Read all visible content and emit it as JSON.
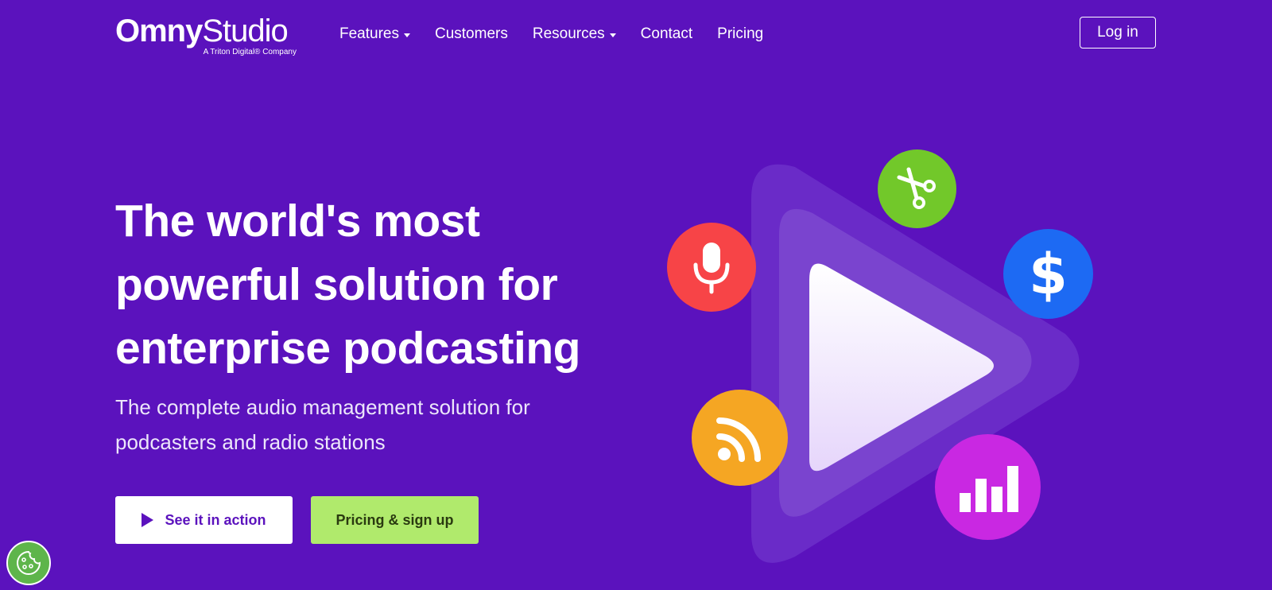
{
  "brand": {
    "logo_main_bold": "Omny",
    "logo_main_light": "Studio",
    "logo_tagline": "A Triton Digital® Company"
  },
  "nav": {
    "features": "Features",
    "customers": "Customers",
    "resources": "Resources",
    "contact": "Contact",
    "pricing": "Pricing",
    "login": "Log in"
  },
  "hero": {
    "headline_line1": "The world's most",
    "headline_line2": "powerful solution for",
    "headline_line3": "enterprise podcasting",
    "subline_line1": "The complete audio management solution for",
    "subline_line2": "podcasters and radio stations",
    "cta_primary": "See it in action",
    "cta_secondary": "Pricing & sign up"
  },
  "illustration": {
    "dollar_symbol": "$",
    "icons": [
      "microphone-icon",
      "scissors-icon",
      "dollar-icon",
      "rss-icon",
      "bar-chart-icon",
      "play-icon"
    ]
  },
  "colors": {
    "background": "#5b12bd",
    "mic": "#f74447",
    "scissors": "#72c82a",
    "dollar": "#1d6af3",
    "rss": "#f5a623",
    "stats": "#c928e2",
    "signup_button": "#b0ea6c",
    "cookie_badge": "#5eb54b"
  }
}
